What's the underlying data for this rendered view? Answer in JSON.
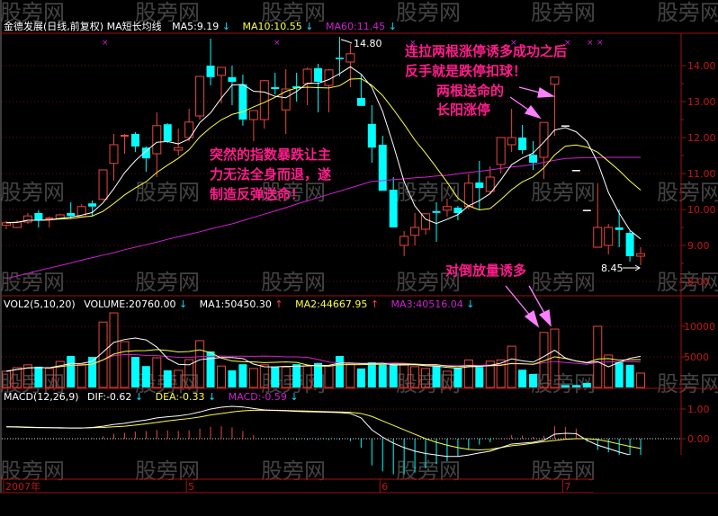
{
  "header": {
    "title": "金德发展(日线,前复权) MA短长均线",
    "ma5": "MA5:9.19",
    "ma10": "MA10:10.55",
    "ma60": "MA60:11.45",
    "vol_title": "VOL2(5,10,20)",
    "volume": "VOLUME:20760.00",
    "vma1": "MA1:50450.30",
    "vma2": "MA2:44667.95",
    "vma3": "MA3:40516.04",
    "macd_title": "MACD(12,26,9)",
    "dif": "DIF:-0.62",
    "dea": "DEA:-0.33",
    "macd": "MACD:-0.59",
    "arrow_down": "↓",
    "arrow_up": "↑"
  },
  "annotations": {
    "top1": "连拉两根涨停诱多成功之后",
    "top2": "反手就是跌停扣球！",
    "mid1": "两根送命的",
    "mid2": "长阳涨停",
    "left1": "突然的指数暴跌让主",
    "left2": "力无法全身而退，遂",
    "left3": "制造反弹送命！",
    "bottom": "对倒放量诱多",
    "high_label": "14.80",
    "low_label": "8.45"
  },
  "watermark": "股旁网",
  "colors": {
    "up": "#e8483c",
    "down": "#00ffff",
    "ma5": "#ffffff",
    "ma10": "#ffff40",
    "ma60": "#d020d0",
    "axis": "#c01818",
    "annotation": "#ff1c8c"
  },
  "chart_data": {
    "type": "candlestick",
    "price_axis": {
      "ticks": [
        "14.00",
        "13.00",
        "12.00",
        "11.00",
        "10.00",
        "9.00",
        "8.00"
      ],
      "range": [
        7.6,
        14.8
      ]
    },
    "volume_axis": {
      "ticks": [
        "10000",
        "5000"
      ],
      "range": [
        0,
        14000
      ]
    },
    "macd_axis": {
      "ticks": [
        "1.00",
        "0.00"
      ],
      "range": [
        -1.4,
        1.6
      ]
    },
    "x_ticks": [
      {
        "label": "2007年",
        "index": 0
      },
      {
        "label": "5",
        "index": 17
      },
      {
        "label": "6",
        "index": 35
      },
      {
        "label": "7",
        "index": 52
      }
    ],
    "ohlc": [
      [
        9.56,
        9.68,
        9.45,
        9.63
      ],
      [
        9.5,
        9.7,
        9.48,
        9.65
      ],
      [
        9.65,
        9.9,
        9.6,
        9.82
      ],
      [
        9.9,
        9.98,
        9.5,
        9.7
      ],
      [
        9.75,
        9.8,
        9.5,
        9.75
      ],
      [
        9.75,
        9.88,
        9.72,
        9.85
      ],
      [
        9.9,
        10.2,
        9.75,
        9.82
      ],
      [
        9.8,
        10.15,
        9.78,
        10.08
      ],
      [
        10.17,
        10.25,
        9.8,
        10.08
      ],
      [
        10.28,
        11.1,
        10.25,
        11.1
      ],
      [
        11.28,
        12.1,
        10.8,
        11.8
      ],
      [
        12.05,
        12.1,
        11.55,
        12.05
      ],
      [
        12.1,
        12.15,
        11.6,
        11.75
      ],
      [
        11.72,
        11.75,
        11.05,
        11.42
      ],
      [
        11.55,
        12.7,
        10.9,
        12.33
      ],
      [
        12.37,
        12.4,
        11.85,
        11.9
      ],
      [
        11.65,
        12.25,
        11.5,
        11.72
      ],
      [
        12.0,
        12.8,
        11.9,
        12.43
      ],
      [
        12.6,
        13.7,
        12.5,
        13.7
      ],
      [
        14.0,
        14.75,
        13.45,
        13.68
      ],
      [
        13.73,
        13.95,
        12.95,
        13.95
      ],
      [
        13.68,
        14.0,
        12.9,
        13.55
      ],
      [
        13.48,
        13.75,
        12.33,
        12.5
      ],
      [
        12.5,
        12.75,
        11.9,
        12.75
      ],
      [
        12.5,
        13.6,
        12.25,
        13.58
      ],
      [
        13.4,
        13.8,
        13.2,
        13.35
      ],
      [
        12.77,
        13.9,
        12.1,
        13.35
      ],
      [
        13.4,
        13.8,
        13.0,
        13.38
      ],
      [
        13.5,
        13.95,
        12.9,
        13.9
      ],
      [
        13.93,
        14.05,
        12.7,
        13.55
      ],
      [
        13.45,
        13.9,
        12.7,
        13.88
      ],
      [
        14.22,
        14.8,
        13.7,
        14.18
      ],
      [
        14.1,
        14.6,
        13.4,
        14.33
      ],
      [
        13.1,
        13.75,
        12.88,
        12.88
      ],
      [
        12.38,
        12.9,
        11.3,
        11.72
      ],
      [
        11.8,
        12.05,
        10.52,
        10.52
      ],
      [
        10.55,
        10.9,
        9.5,
        9.5
      ],
      [
        9.0,
        9.4,
        8.7,
        9.25
      ],
      [
        9.28,
        9.9,
        9.0,
        9.5
      ],
      [
        9.45,
        9.9,
        9.3,
        9.88
      ],
      [
        9.93,
        10.2,
        9.1,
        9.92
      ],
      [
        9.98,
        10.3,
        9.8,
        10.08
      ],
      [
        10.05,
        10.1,
        9.7,
        9.9
      ],
      [
        10.08,
        11.0,
        10.0,
        10.73
      ],
      [
        10.75,
        11.35,
        10.0,
        10.6
      ],
      [
        10.5,
        11.2,
        10.45,
        10.9
      ],
      [
        11.25,
        12.0,
        11.0,
        12.0
      ],
      [
        11.8,
        12.8,
        11.6,
        12.0
      ],
      [
        12.0,
        12.35,
        11.55,
        11.65
      ],
      [
        11.52,
        11.9,
        11.1,
        11.3
      ],
      [
        11.45,
        12.42,
        10.85,
        12.42
      ],
      [
        13.48,
        13.68,
        12.05,
        13.68
      ],
      [
        12.32,
        12.32,
        12.32,
        12.32
      ],
      [
        11.08,
        11.08,
        11.08,
        11.08
      ],
      [
        9.97,
        9.97,
        9.97,
        9.97
      ],
      [
        8.95,
        10.73,
        8.95,
        9.5
      ],
      [
        9.0,
        9.6,
        8.75,
        9.5
      ],
      [
        9.5,
        10.0,
        8.95,
        9.43
      ],
      [
        9.35,
        9.4,
        8.55,
        8.7
      ],
      [
        8.7,
        8.95,
        8.45,
        8.77
      ]
    ],
    "ma60": [
      8.08,
      8.15,
      8.22,
      8.3,
      8.37,
      8.44,
      8.51,
      8.59,
      8.66,
      8.73,
      8.8,
      8.88,
      8.95,
      9.02,
      9.09,
      9.17,
      9.24,
      9.31,
      9.38,
      9.46,
      9.53,
      9.6,
      9.69,
      9.78,
      9.87,
      9.96,
      10.05,
      10.15,
      10.24,
      10.33,
      10.42,
      10.51,
      10.6,
      10.69,
      10.78,
      10.8,
      10.83,
      10.85,
      10.88,
      10.9,
      10.93,
      10.95,
      10.99,
      11.03,
      11.06,
      11.1,
      11.14,
      11.18,
      11.21,
      11.25,
      11.31,
      11.37,
      11.42,
      11.43,
      11.44,
      11.44,
      11.45,
      11.45,
      11.45,
      11.45
    ],
    "volume": [
      2650,
      3240,
      3700,
      3400,
      3100,
      4260,
      5150,
      3800,
      5000,
      10700,
      12200,
      7500,
      5000,
      3500,
      4850,
      2800,
      2800,
      4560,
      7650,
      5900,
      3500,
      2800,
      3800,
      3100,
      3700,
      3400,
      3300,
      3800,
      3500,
      4000,
      3500,
      5150,
      3800,
      3100,
      4100,
      3700,
      3700,
      3800,
      3400,
      3100,
      3500,
      2650,
      3200,
      4500,
      3350,
      4300,
      4500,
      6750,
      2900,
      2200,
      9000,
      9550,
      400,
      400,
      750,
      10000,
      5300,
      4100,
      3700,
      2350
    ],
    "dif": [
      0.4,
      0.4,
      0.39,
      0.38,
      0.37,
      0.37,
      0.36,
      0.36,
      0.38,
      0.42,
      0.48,
      0.52,
      0.58,
      0.63,
      0.7,
      0.74,
      0.77,
      0.82,
      0.9,
      1.0,
      1.06,
      1.09,
      1.07,
      1.02,
      0.97,
      0.95,
      0.94,
      0.92,
      0.91,
      0.9,
      0.89,
      0.88,
      0.85,
      0.7,
      0.3,
      0.05,
      -0.15,
      -0.3,
      -0.42,
      -0.5,
      -0.55,
      -0.6,
      -0.6,
      -0.55,
      -0.48,
      -0.42,
      -0.3,
      -0.18,
      -0.15,
      -0.12,
      -0.05,
      0.15,
      0.18,
      0.17,
      -0.05,
      -0.22,
      -0.33,
      -0.45,
      -0.55,
      -0.62
    ],
    "dea": [
      0.4,
      0.39,
      0.38,
      0.37,
      0.37,
      0.36,
      0.36,
      0.36,
      0.37,
      0.38,
      0.4,
      0.42,
      0.46,
      0.5,
      0.55,
      0.6,
      0.64,
      0.68,
      0.73,
      0.8,
      0.85,
      0.9,
      0.94,
      0.96,
      0.96,
      0.96,
      0.95,
      0.94,
      0.93,
      0.92,
      0.91,
      0.9,
      0.89,
      0.85,
      0.75,
      0.6,
      0.45,
      0.3,
      0.15,
      0.0,
      -0.12,
      -0.22,
      -0.3,
      -0.36,
      -0.38,
      -0.36,
      -0.3,
      -0.24,
      -0.2,
      -0.15,
      -0.1,
      -0.06,
      -0.02,
      0.0,
      0.0,
      -0.03,
      -0.1,
      -0.18,
      -0.26,
      -0.33
    ],
    "macd": [
      0,
      0.02,
      0.02,
      0.02,
      0,
      0.02,
      0,
      0,
      0.02,
      0.08,
      0.16,
      0.2,
      0.24,
      0.26,
      0.3,
      0.28,
      0.26,
      0.28,
      0.34,
      0.4,
      0.42,
      0.38,
      0.26,
      0.12,
      0.02,
      -0.02,
      -0.02,
      -0.04,
      -0.04,
      -0.04,
      -0.04,
      -0.04,
      -0.08,
      -0.3,
      -0.9,
      -1.1,
      -1.2,
      -1.2,
      -1.14,
      -1.0,
      -0.86,
      -0.76,
      -0.6,
      -0.38,
      -0.2,
      -0.12,
      0,
      0.12,
      0.1,
      0.06,
      0.1,
      0.42,
      0.4,
      0.34,
      -0.1,
      -0.38,
      -0.46,
      -0.54,
      -0.58,
      -0.58
    ]
  }
}
